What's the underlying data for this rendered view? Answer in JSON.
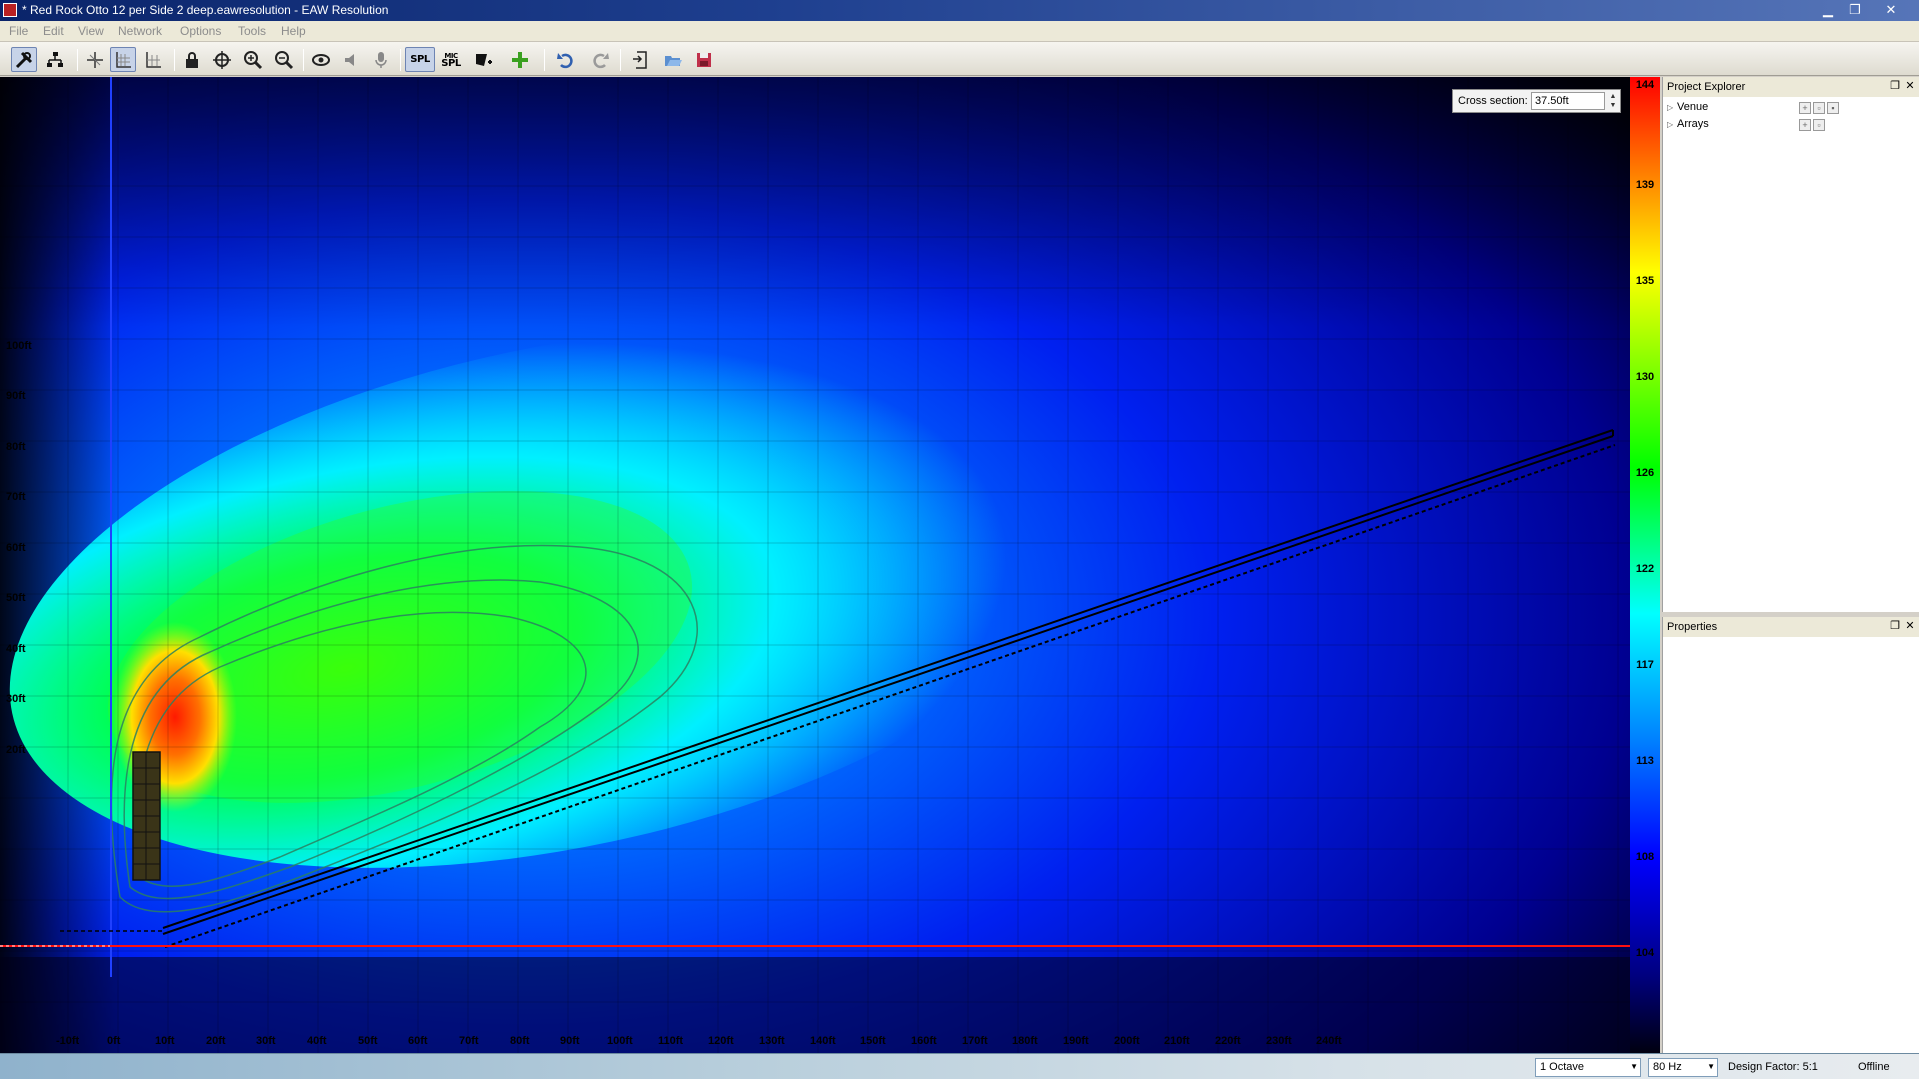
{
  "window": {
    "title": "* Red Rock Otto 12 per Side 2 deep.eawresolution - EAW Resolution",
    "buttons": [
      "minimize",
      "restore",
      "close"
    ]
  },
  "menu": [
    "File",
    "Edit",
    "View",
    "Network",
    "Options",
    "Tools",
    "Help"
  ],
  "toolbar": {
    "spl_label": "SPL",
    "mic_label_top": "MIC",
    "mic_label_bottom": "SPL"
  },
  "plot": {
    "cross_section_label": "Cross section:",
    "cross_section_value": "37.50ft",
    "y_labels": [
      "100ft",
      "90ft",
      "80ft",
      "70ft",
      "60ft",
      "50ft",
      "40ft",
      "30ft",
      "20ft"
    ],
    "x_labels": [
      "-10ft",
      "0ft",
      "10ft",
      "20ft",
      "30ft",
      "40ft",
      "50ft",
      "60ft",
      "70ft",
      "80ft",
      "90ft",
      "100ft",
      "110ft",
      "120ft",
      "130ft",
      "140ft",
      "150ft",
      "160ft",
      "170ft",
      "180ft",
      "190ft",
      "200ft",
      "210ft",
      "220ft",
      "230ft",
      "240ft"
    ]
  },
  "scale": {
    "ticks": [
      "144",
      "139",
      "135",
      "130",
      "126",
      "122",
      "117",
      "113",
      "108",
      "104"
    ]
  },
  "panels": {
    "project_explorer": {
      "title": "Project Explorer",
      "items": [
        "Venue",
        "Arrays"
      ]
    },
    "properties": {
      "title": "Properties"
    }
  },
  "status": {
    "bandwidth": "1 Octave",
    "frequency": "80 Hz",
    "design_factor": "Design Factor: 5:1",
    "connection": "Offline"
  },
  "colors": {
    "title_bar": "#0a246a",
    "field_peak": "#ff2a00",
    "field_mid": "#00ff40",
    "field_low": "#0000ff",
    "ground_line": "#ff0000"
  }
}
